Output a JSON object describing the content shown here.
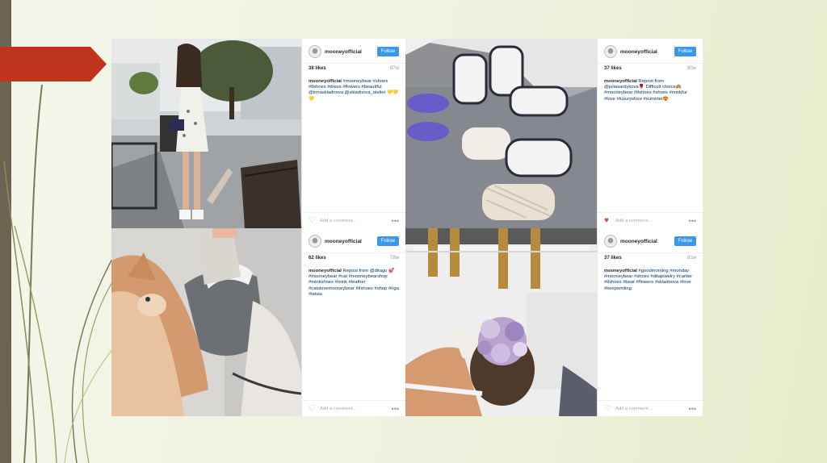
{
  "posts": [
    {
      "username": "mooneyofficial",
      "follow_label": "Follow",
      "likes": "38 likes",
      "age": "87w",
      "caption_user": "mooneyofficial",
      "caption_text": "#mooneybear #shoes #tlshoes #dress #flowers #beautiful @innaskladnova @skladnova_atelier 💛💛💛",
      "comment_placeholder": "Add a comment...",
      "more": "•••",
      "liked": false
    },
    {
      "username": "mooneyofficial",
      "follow_label": "Follow",
      "likes": "37 likes",
      "age": "80w",
      "caption_user": "mooneyofficial",
      "caption_text": "Repost from @juliasardykova🌹 Difficult choice🙈 #mooneybear #tlshoes #shoes #minkfur #love #luxurystore #summer😍",
      "comment_placeholder": "Add a comment...",
      "more": "•••",
      "liked": true
    },
    {
      "username": "mooneyofficial",
      "follow_label": "Follow",
      "likes": "62 likes",
      "age": "78w",
      "caption_user": "mooneyofficial",
      "caption_text": "Repost from @ditagu 💕 #mooneybear #cat #mooneybearshop #minkshoes #mink #leather #catslovemooneybear #tlshoes #shop #riga #latvia",
      "comment_placeholder": "Add a comment...",
      "more": "•••",
      "liked": false
    },
    {
      "username": "mooneyofficial",
      "follow_label": "Follow",
      "likes": "37 likes",
      "age": "81w",
      "caption_user": "mooneyofficial",
      "caption_text": "#goodmorning #monday #mooneybear #shoes #ditajewelry #cartier #tlshoes #bear #flowers #skladnova #love #keepsmiling",
      "comment_placeholder": "Add a comment...",
      "more": "•••",
      "liked": false
    }
  ],
  "colors": {
    "follow": "#3897f0",
    "arrow": "#c0341d",
    "left_bar": "#6b6450",
    "heart_liked": "#e53c4a"
  }
}
